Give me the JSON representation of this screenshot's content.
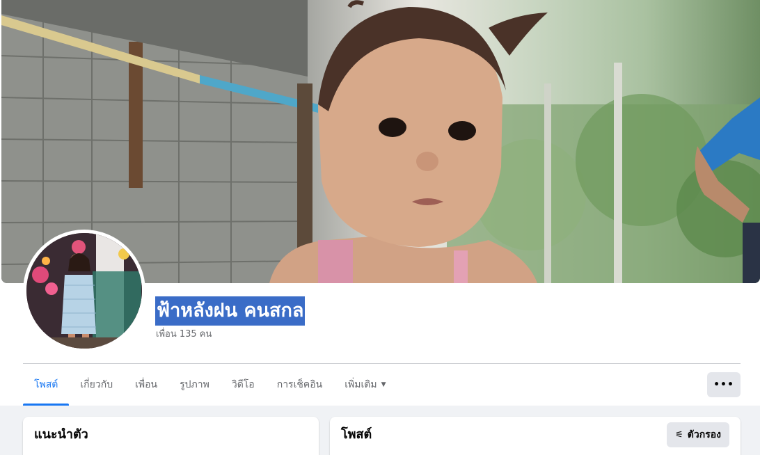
{
  "profile": {
    "name": "ฟ้าหลังฝน คนสกล",
    "friends": "เพื่อน 135 คน"
  },
  "tabs": [
    {
      "label": "โพสต์",
      "active": true
    },
    {
      "label": "เกี่ยวกับ"
    },
    {
      "label": "เพื่อน"
    },
    {
      "label": "รูปภาพ"
    },
    {
      "label": "วิดีโอ"
    },
    {
      "label": "การเช็คอิน"
    },
    {
      "label": "เพิ่มเติม",
      "icon": "chevron-down-icon"
    }
  ],
  "more_button": {
    "label": "•••",
    "icon": "more-options-icon"
  },
  "intro_card": {
    "title": "แนะนำตัว"
  },
  "posts_card": {
    "title": "โพสต์",
    "filter_label": "ตัวกรอง",
    "filter_icon": "filter-icon"
  },
  "colors": {
    "accent": "#1877f2",
    "name_highlight": "#3a6cc7",
    "secondary_text": "#65676b",
    "button_bg": "#e4e6eb",
    "page_bg": "#f0f2f5"
  }
}
